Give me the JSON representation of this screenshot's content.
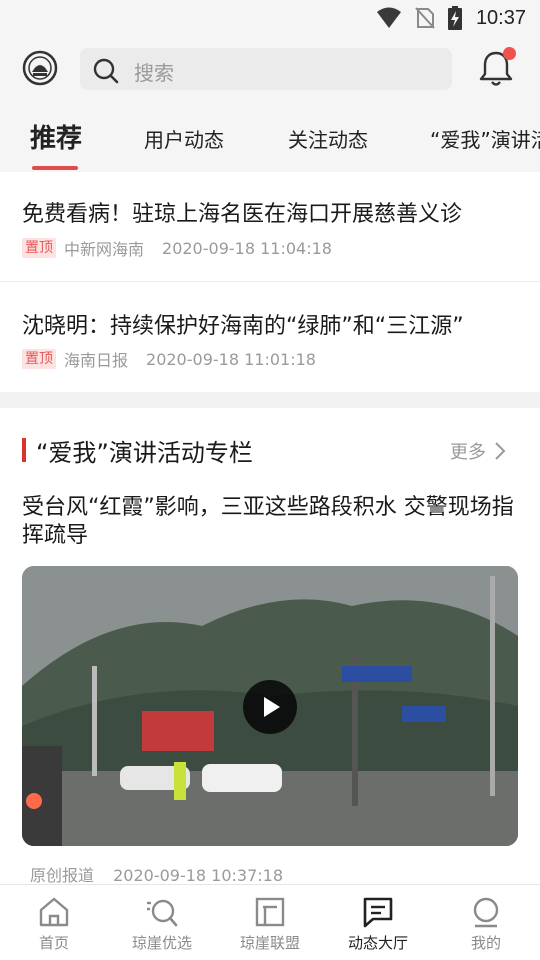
{
  "status_bar": {
    "time": "10:37"
  },
  "header": {
    "search_placeholder": "搜索"
  },
  "tabs": [
    {
      "label": "推荐",
      "active": true
    },
    {
      "label": "用户动态",
      "active": false
    },
    {
      "label": "关注动态",
      "active": false
    },
    {
      "label": "“爱我”演讲活",
      "active": false
    }
  ],
  "pinned_news": [
    {
      "title": "免费看病！驻琼上海名医在海口开展慈善义诊",
      "badge": "置顶",
      "source": "中新网海南",
      "time": "2020-09-18 11:04:18"
    },
    {
      "title": "沈晓明：持续保护好海南的“绿肺”和“三江源”",
      "badge": "置顶",
      "source": "海南日报",
      "time": "2020-09-18 11:01:18"
    }
  ],
  "section": {
    "title": "“爱我”演讲活动专栏",
    "more_label": "更多",
    "article": {
      "title": "受台风“红霞”影响，三亚这些路段积水 交警现场指挥疏导",
      "source": "原创报道",
      "time": "2020-09-18 10:37:18"
    }
  },
  "bottom_nav": [
    {
      "label": "首页",
      "icon": "home-icon",
      "active": false
    },
    {
      "label": "琼崖优选",
      "icon": "discover-icon",
      "active": false
    },
    {
      "label": "琼崖联盟",
      "icon": "alliance-icon",
      "active": false
    },
    {
      "label": "动态大厅",
      "icon": "message-icon",
      "active": true
    },
    {
      "label": "我的",
      "icon": "profile-icon",
      "active": false
    }
  ],
  "colors": {
    "accent": "#d8342c",
    "badge_bg": "#fde2e2",
    "badge_text": "#e45a5a"
  }
}
